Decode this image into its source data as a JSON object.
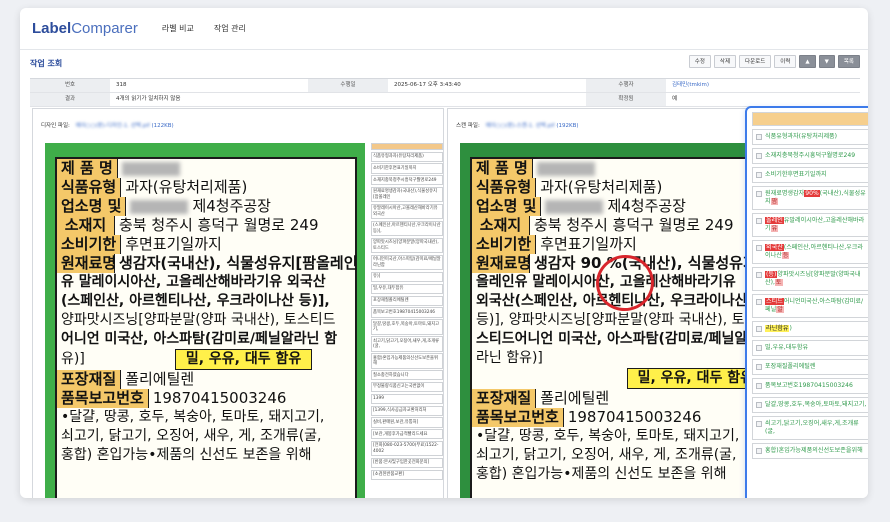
{
  "app": {
    "logo_bold": "Label",
    "logo_light": "Comparer"
  },
  "nav": {
    "items": [
      "라벨 비교",
      "작업 관리"
    ]
  },
  "page": {
    "title": "작업 조회"
  },
  "toolbar": {
    "buttons": [
      "수정",
      "삭제",
      "다운로드",
      "이력",
      "▲",
      "▼",
      "목록"
    ]
  },
  "info": {
    "no_label": "번호",
    "no_value": "318",
    "time_label": "수행일",
    "time_value": "2025-06-17 오후 3:43:40",
    "user_label": "수행자",
    "user_value": "김태민(tmkim)",
    "result_label": "결과",
    "result_value": "4개의 읽기가 일치하지 않음",
    "confirm_label": "확정됨",
    "confirm_value": "예"
  },
  "design": {
    "head_label": "디자인 파일:",
    "filename": "에이○○(판)-디자인-1. 선택.pif",
    "size": "(122KB)"
  },
  "scan": {
    "head_label": "스캔 파일:",
    "filename": "에이○○(판)-스캔-1. 선택.pif",
    "size": "(192KB)"
  },
  "label": {
    "r1_k": "제 품 명",
    "r2_k": "식품유형",
    "r2_v": "과자(유탕처리제품)",
    "r3_k": "업소명 및",
    "r3_v": "제4청주공장",
    "r4_k": "소재지",
    "r4_v": "충북 청주시 흥덕구 월명로 249",
    "r5_k": "소비기한",
    "r5_v": "후면표기일까지",
    "r6_k": "원재료명",
    "design_ing1": "생감자(국내산), 식물성유지[팜올레인",
    "design_ing2": "유 말레이시아산, 고올레산해바라기유 외국산",
    "design_ing3": "(스페인산, 아르헨티나산, 우크라이나산 등)],",
    "design_ing4": "양파맛시즈닝[양파분말(양파 국내산), 토스티드",
    "design_ing5": "어니언 미국산, 아스파탐(감미료/페닐알라닌 함",
    "design_ing6": "유)]",
    "scan_ing1": "생감자 90 %(국내산), 식물성유지[팜",
    "scan_ing2": "올레인유 말레이시아산, 고올레산해바라기유",
    "scan_ing3": "외국산(스페인산, 아르헨티나산, 우크라이나산",
    "scan_ing4": "등)], 양파맛시즈닝[양파분말(양파 국내산), 토",
    "scan_ing5": "스티드어니언 미국산, 아스파탐(감미료/페닐알",
    "scan_ing6": "라닌 함유)]",
    "allergen": "밀, 우유, 대두 함유",
    "r7_k": "포장재질",
    "r7_v": "폴리에틸렌",
    "r8_k": "품목보고번호",
    "r8_v": "19870415003246",
    "bottom1": "•달걀, 땅콩, 호두, 복숭아, 토마토, 돼지고기,",
    "bottom2": "쇠고기, 닭고기, 오징어, 새우, 게, 조개류(굴,",
    "bottom3": "홍합) 혼입가능•제품의 신선도 보존을 위해"
  },
  "design_list": [
    "",
    "식품유형과자(유탕처리제품)",
    "소비기한후면표기일까지",
    "소재지충북청주시흥덕구월명로249",
    "원재료명생감자(국내산),식물성유지[팜올레인",
    "유말레이시아산,고올레산해바라기유외국산",
    "(스페인산,아르헨티나산,우크라이나산등)],",
    "양파맛시즈닝[양파분말(양파국내산),토스티드",
    "어니언미국산,아스파탐(감미료/페닐알라닌함",
    "유)]",
    "밀,우유,대두함유",
    "포장재질폴리에틸렌",
    "품목보고번호19870415003246",
    "달걀,땅콩,호두,복숭아,토마토,돼지고기,",
    "쇠고기,닭고기,오징어,새우,게,조개류(굴,",
    "홍합)혼입가능제품의신선도보존을위해",
    "질소충전하였습니다",
    "부정불량식품신고는국번없이",
    "1399",
    "[1399,식사공급자교환처리처",
    "실비,판매원,보관,유통처]",
    "[보관,개봉후가급적빨리드세요",
    "[전화]080-023-5700(무료)1522-4002",
    "[반품:본사및구입한곳전화문의]",
    "[소검된반품교환]"
  ],
  "panel": [
    {
      "text": "",
      "dark": false
    },
    {
      "text": "식품유형과자(유탕처리제품)",
      "dark": false
    },
    {
      "text": "소재지충북청주시흥덕구월명로249",
      "dark": false
    },
    {
      "text": "소비기한후면표기일까지",
      "dark": false
    },
    {
      "pre": "원재료명생감자",
      "hl": "90%",
      "hlclass": "hl-red",
      "post": "(국내산),식물성유지",
      "tail": "팜",
      "tailclass": "hl-pink"
    },
    {
      "pre": "",
      "hl": "올레인",
      "hlclass": "hl-red",
      "post": "유말레이시아산,고올레산해바라기",
      "tail": "유",
      "tailclass": "hl-pink"
    },
    {
      "pre": "",
      "hl": "외국산",
      "hlclass": "hl-red",
      "post": "(스페인산,아르헨티나산,우크라이나산",
      "tail": "등",
      "tailclass": "hl-pink"
    },
    {
      "pre": "",
      "hl": "(등)",
      "hlclass": "hl-red",
      "post": "양파맛시즈닝[양파분말(양파국내산),",
      "tail": "토",
      "tailclass": "hl-pink"
    },
    {
      "pre": "",
      "hl": "스티드",
      "hlclass": "hl-red",
      "post": "어니언미국산,아스파탐(감미료/페닐",
      "tail": "알",
      "tailclass": "hl-pink"
    },
    {
      "pre": "",
      "hl": "라닌함유",
      "hlclass": "hl-yellow",
      "post": ")",
      "tail": "",
      "tailclass": ""
    },
    {
      "text": "밀,우유,대두함유",
      "dark": false
    },
    {
      "text": "포장재질폴리에틸렌",
      "dark": false
    },
    {
      "text": "품목보고번호19870415003246",
      "dark": false
    },
    {
      "text": "달걀,땅콩,호두,복숭아,토마토,돼지고기,",
      "dark": false
    },
    {
      "text": "쇠고기,닭고기,오징어,새우,게,조개류(굴,",
      "dark": false
    },
    {
      "text": "홍합)혼입가능제품의신선도보존을위해",
      "dark": false
    }
  ],
  "colors": {
    "accent": "#3d7bea",
    "label_bg": "#3fae49",
    "key_bg": "#f4c869",
    "diff_red": "#e43b3b"
  }
}
